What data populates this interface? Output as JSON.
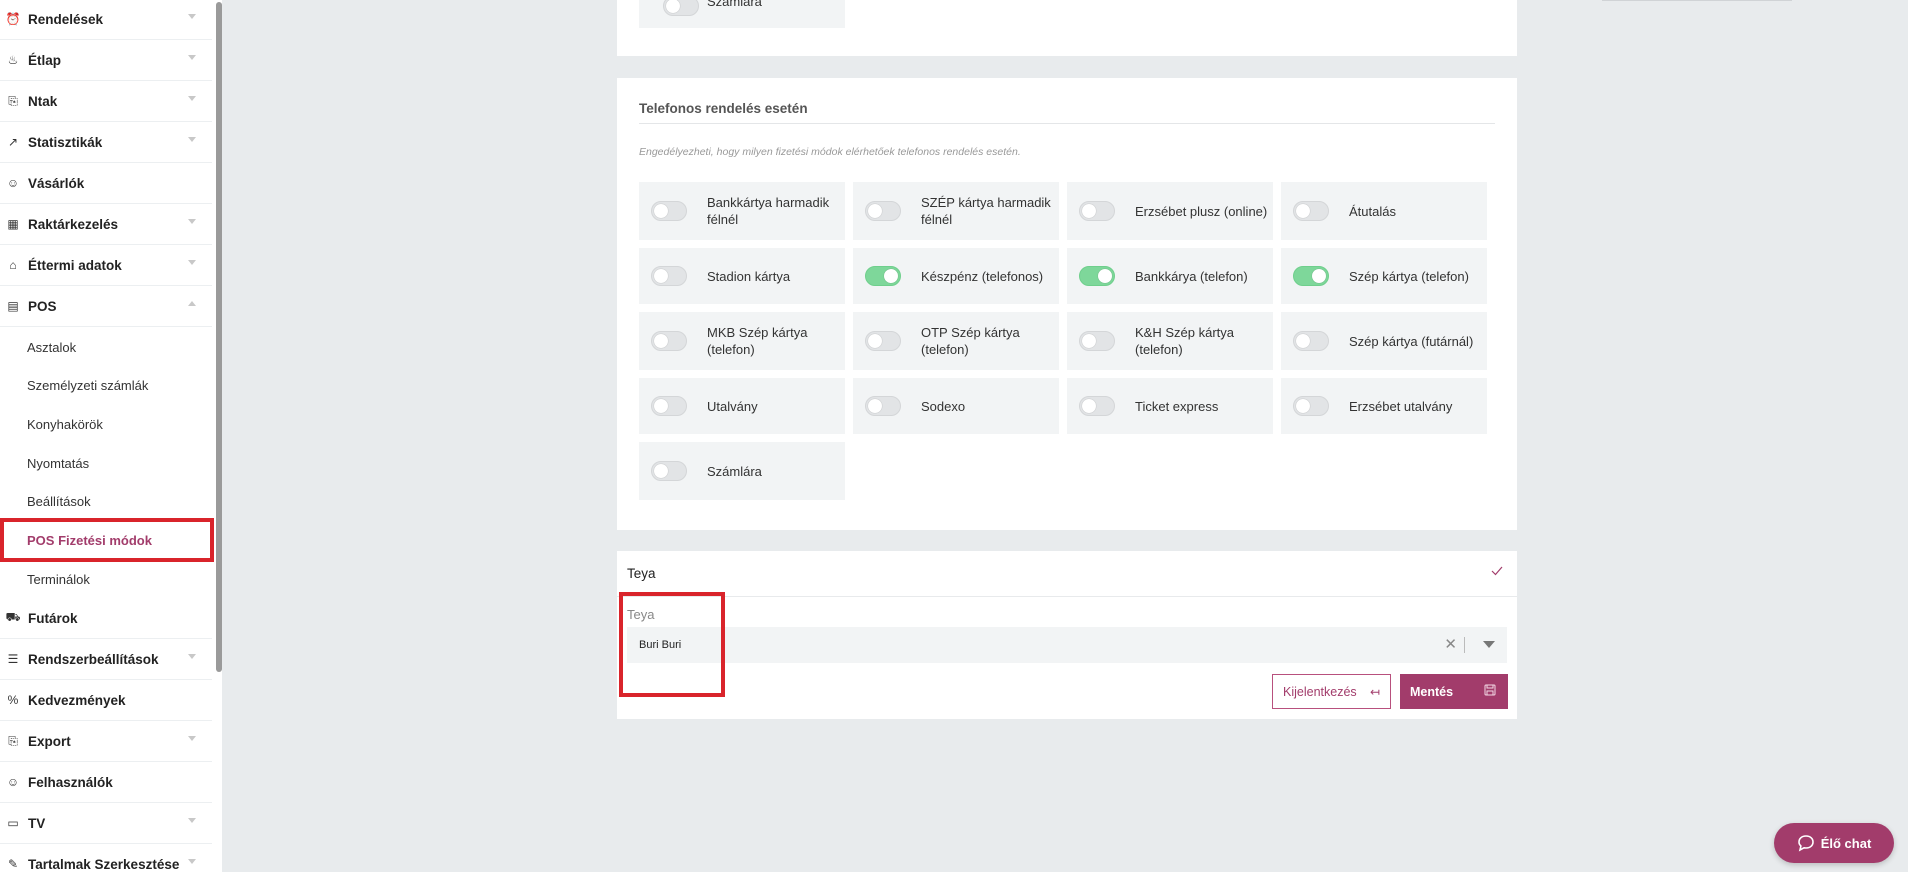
{
  "sidebar": {
    "items": [
      {
        "label": "Rendelések",
        "icon": "alarm-clock-icon",
        "glyph": "⏰",
        "chevron": "down"
      },
      {
        "label": "Étlap",
        "icon": "pot-icon",
        "glyph": "♨",
        "chevron": "down"
      },
      {
        "label": "Ntak",
        "icon": "document-export-icon",
        "glyph": "⎘",
        "chevron": "down"
      },
      {
        "label": "Statisztikák",
        "icon": "chart-icon",
        "glyph": "↗",
        "chevron": "down"
      },
      {
        "label": "Vásárlók",
        "icon": "users-icon",
        "glyph": "☺",
        "chevron": "none"
      },
      {
        "label": "Raktárkezelés",
        "icon": "boxes-icon",
        "glyph": "▦",
        "chevron": "down"
      },
      {
        "label": "Éttermi adatok",
        "icon": "store-icon",
        "glyph": "⌂",
        "chevron": "down"
      },
      {
        "label": "POS",
        "icon": "pos-terminal-icon",
        "glyph": "▤",
        "chevron": "up"
      }
    ],
    "pos_subitems": [
      {
        "label": "Asztalok"
      },
      {
        "label": "Személyzeti számlák"
      },
      {
        "label": "Konyhakörök"
      },
      {
        "label": "Nyomtatás"
      },
      {
        "label": "Beállítások"
      },
      {
        "label": "POS Fizetési módok",
        "active": true
      },
      {
        "label": "Terminálok"
      }
    ],
    "items_after": [
      {
        "label": "Futárok",
        "icon": "scooter-icon",
        "glyph": "⛟",
        "chevron": "none"
      },
      {
        "label": "Rendszerbeállítások",
        "icon": "sliders-icon",
        "glyph": "☰",
        "chevron": "down"
      },
      {
        "label": "Kedvezmények",
        "icon": "percent-icon",
        "glyph": "%",
        "chevron": "none"
      },
      {
        "label": "Export",
        "icon": "file-export-icon",
        "glyph": "⎘",
        "chevron": "down"
      },
      {
        "label": "Felhasználók",
        "icon": "user-circle-icon",
        "glyph": "☺",
        "chevron": "none"
      },
      {
        "label": "TV",
        "icon": "monitor-icon",
        "glyph": "▭",
        "chevron": "down"
      },
      {
        "label": "Tartalmak Szerkesztése",
        "icon": "edit-icon",
        "glyph": "✎",
        "chevron": "down"
      }
    ]
  },
  "top_card": {
    "partial_label": "Számlára"
  },
  "phone_section": {
    "title": "Telefonos rendelés esetén",
    "description": "Engedélyezheti, hogy milyen fizetési módok elérhetőek telefonos rendelés esetén.",
    "methods": [
      {
        "label": "Bankkártya harmadik félnél",
        "on": false
      },
      {
        "label": "SZÉP kártya harmadik félnél",
        "on": false
      },
      {
        "label": "Erzsébet plusz (online)",
        "on": false
      },
      {
        "label": "Átutalás",
        "on": false
      },
      {
        "label": "Stadion kártya",
        "on": false
      },
      {
        "label": "Készpénz (telefonos)",
        "on": true
      },
      {
        "label": "Bankkárya (telefon)",
        "on": true
      },
      {
        "label": "Szép kártya (telefon)",
        "on": true
      },
      {
        "label": "MKB Szép kártya (telefon)",
        "on": false
      },
      {
        "label": "OTP Szép kártya (telefon)",
        "on": false
      },
      {
        "label": "K&H Szép kártya (telefon)",
        "on": false
      },
      {
        "label": "Szép kártya (futárnál)",
        "on": false
      },
      {
        "label": "Utalvány",
        "on": false
      },
      {
        "label": "Sodexo",
        "on": false
      },
      {
        "label": "Ticket express",
        "on": false
      },
      {
        "label": "Erzsébet utalvány",
        "on": false
      },
      {
        "label": "Számlára",
        "on": false
      }
    ]
  },
  "teya": {
    "header": "Teya",
    "field_label": "Teya",
    "selected_value": "Buri Buri",
    "clear_symbol": "✕",
    "logout_label": "Kijelentkezés",
    "logout_icon": "↤",
    "save_label": "Mentés"
  },
  "chat": {
    "label": "Élő chat"
  },
  "colors": {
    "accent": "#a23c6b",
    "toggle_on": "#7ed79a",
    "highlight": "#d9242b"
  }
}
